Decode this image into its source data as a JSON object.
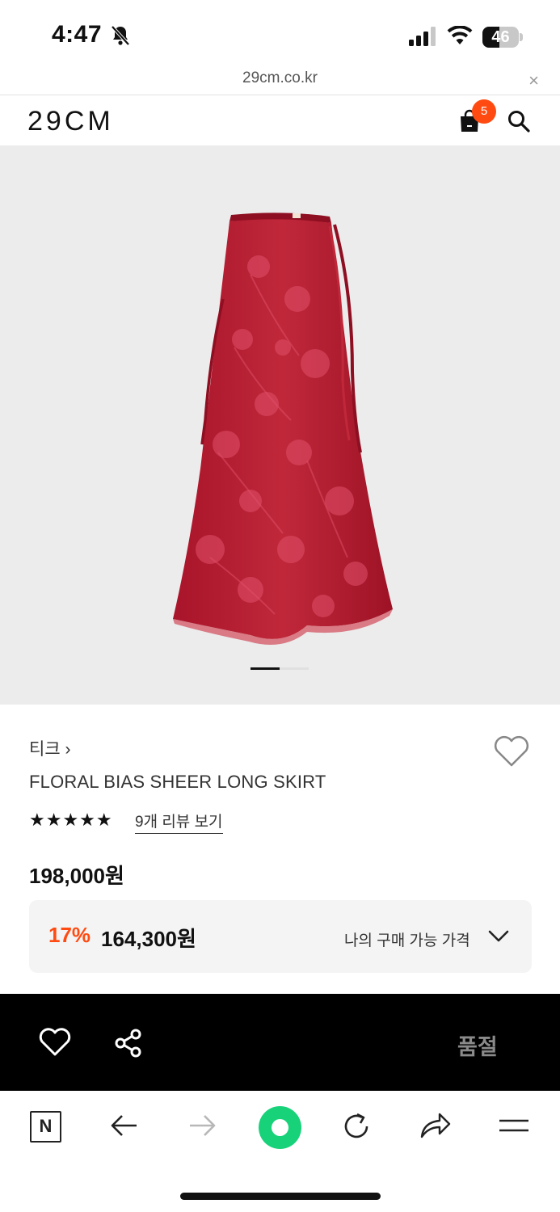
{
  "status_bar": {
    "time": "4:47",
    "battery_percent": "46",
    "battery_level": 0.46,
    "icons": [
      "bell-muted-icon",
      "cellular-signal-icon",
      "wifi-icon",
      "battery-icon"
    ]
  },
  "browser": {
    "url": "29cm.co.kr",
    "close_icon": "×"
  },
  "header": {
    "logo": "29CM",
    "cart_count": "5",
    "icons": [
      "shopping-bag-icon",
      "search-icon"
    ],
    "accent_color": "#ff4b12"
  },
  "product": {
    "image_desc_icon": "product-image",
    "image_page": 1,
    "image_pages": 2,
    "brand": "티크 ›",
    "name": "FLORAL BIAS SHEER LONG SKIRT",
    "stars": "★★★★★",
    "rating": 5,
    "reviews_link": "9개 리뷰 보기",
    "price": "198,000원",
    "discount": "17%",
    "sale_price": "164,300원",
    "my_price_label": "나의 구매 가능 가격"
  },
  "action_bar": {
    "soldout_label": "품절",
    "icons": [
      "heart-icon",
      "share-icon"
    ]
  },
  "toolbar": {
    "n_label": "N",
    "icons": [
      "naver-n-icon",
      "back-arrow-icon",
      "forward-arrow-icon",
      "green-dot-icon",
      "reload-icon",
      "share-arrow-icon",
      "menu-icon"
    ]
  }
}
